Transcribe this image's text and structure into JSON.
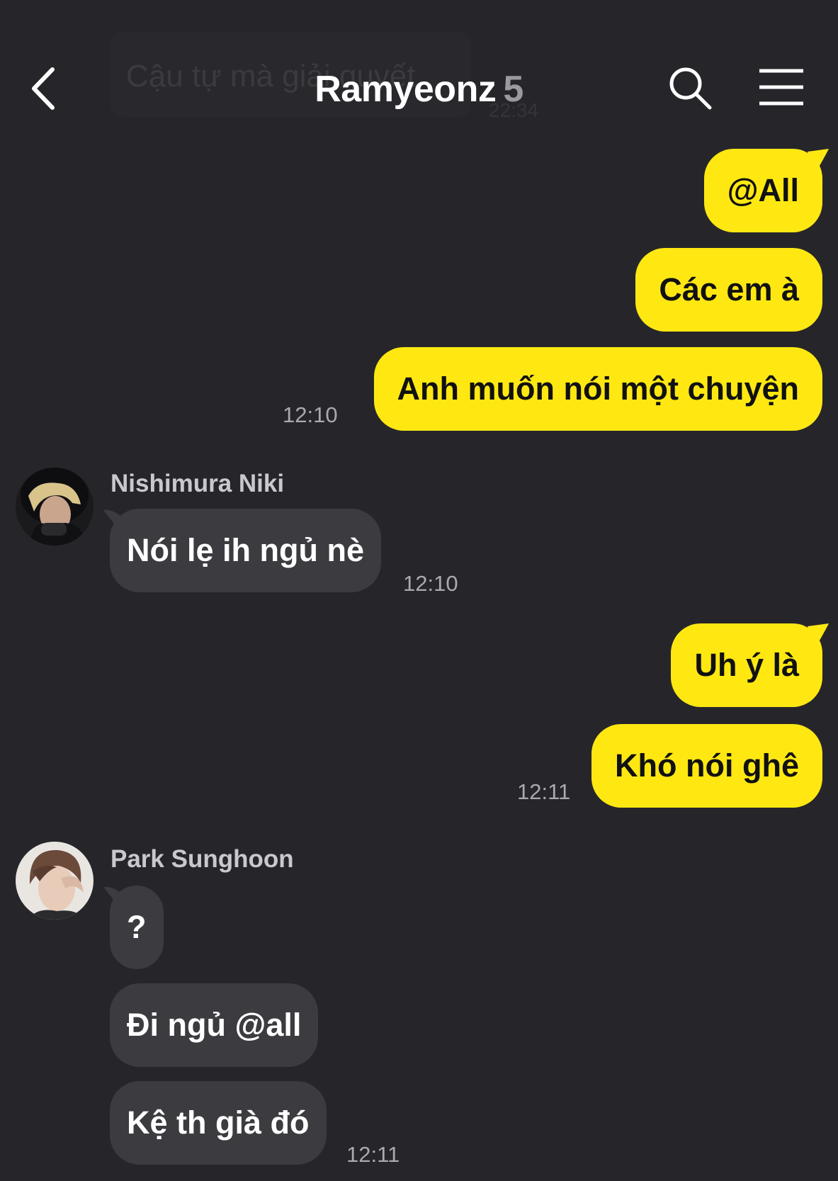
{
  "background_preview": {
    "text": "Cậu tự mà giải quyết",
    "time": "22:34"
  },
  "header": {
    "title": "Ramyeonz",
    "member_count": "5",
    "back_icon": "chevron-left-icon",
    "search_icon": "search-icon",
    "menu_icon": "hamburger-menu-icon"
  },
  "colors": {
    "background": "#26262a",
    "my_bubble": "#ffe812",
    "their_bubble": "#3b3b40",
    "timestamp": "#a9a9ae"
  },
  "messages": {
    "m1": {
      "text": "@All"
    },
    "m2": {
      "text": "Các em à"
    },
    "m3": {
      "text": "Anh muốn nói một chuyện",
      "time": "12:10"
    },
    "niki": {
      "sender": "Nishimura Niki",
      "text": "Nói lẹ ih ngủ nè",
      "time": "12:10"
    },
    "m4": {
      "text": "Uh ý là"
    },
    "m5": {
      "text": "Khó nói ghê",
      "time": "12:11"
    },
    "sunghoon": {
      "sender": "Park Sunghoon",
      "texts": [
        "?",
        "Đi ngủ @all",
        "Kệ th già đó"
      ],
      "time": "12:11"
    }
  }
}
